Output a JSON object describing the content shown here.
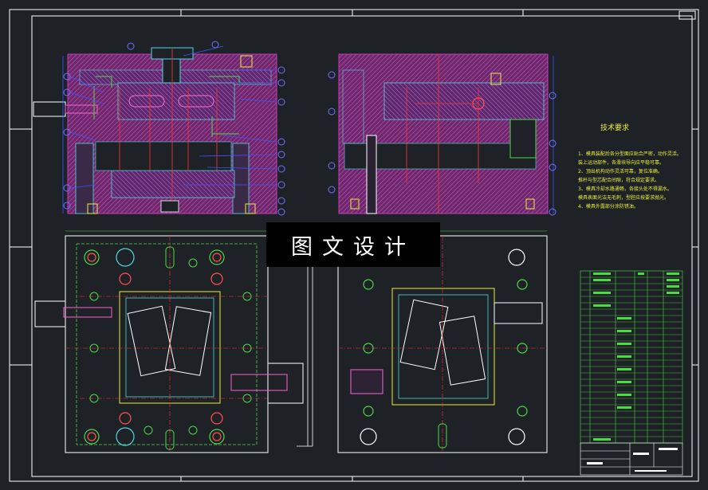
{
  "watermark": {
    "text": "图文设计"
  },
  "tech_notes": {
    "title": "技术要求",
    "lines": [
      "1、模具装配后各分型面应贴合严密，动作灵活。",
      "装上运动部件，各滑块导向应平稳可靠。",
      "2、顶出机构动作灵活可靠，复位准确。",
      "推杆与型芯配合间隙，符合规定要求。",
      "3、模具冷却水路通畅，各接头处不得漏水。",
      "模具表面光洁无毛刺，型腔应按要求抛光。",
      "4、模具外露部分涂防锈油。"
    ]
  },
  "colors": {
    "background": "#1e2227",
    "frame": "#ffffff",
    "hatch": "#c0359e",
    "plate": "#b34bb5",
    "outline": "#4fd7e0",
    "green": "#4cd945",
    "yellow": "#e8ef3a",
    "red": "#ff3030",
    "blue": "#3a56ff",
    "bubble": "#6f72ff"
  },
  "icons": [
    "balloon-callout-icon",
    "screw-icon",
    "guide-pillar-icon"
  ]
}
